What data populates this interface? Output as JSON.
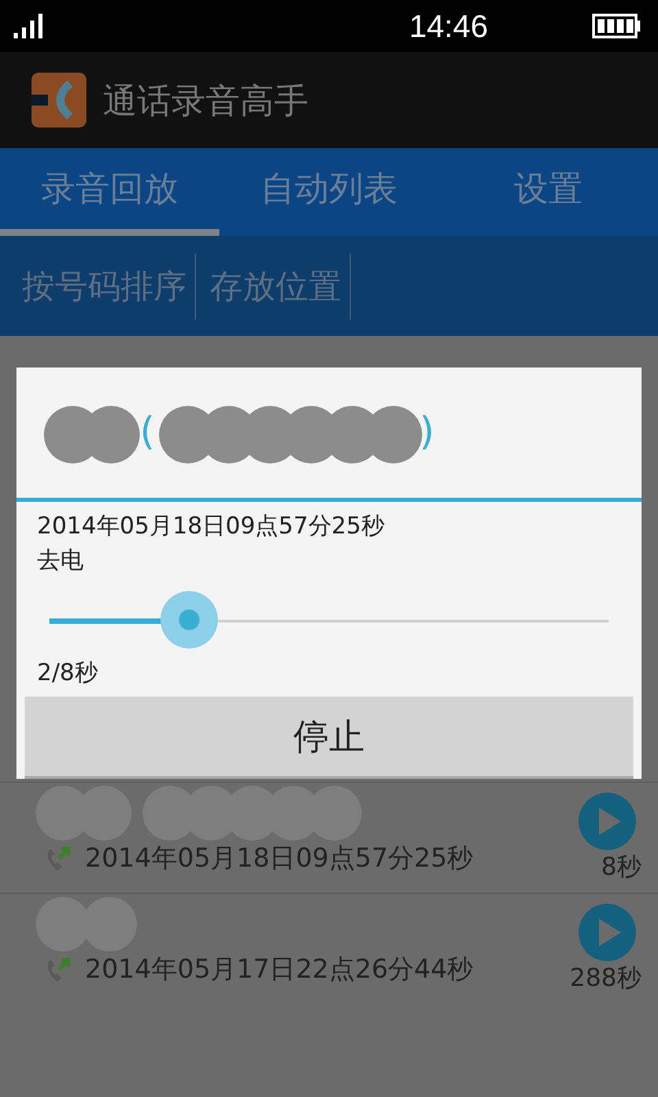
{
  "status_bar": {
    "time": "14:46"
  },
  "app_bar": {
    "title": "通话录音高手"
  },
  "tabs": [
    {
      "label": "录音回放",
      "selected": true
    },
    {
      "label": "自动列表",
      "selected": false
    },
    {
      "label": "设置",
      "selected": false
    }
  ],
  "toolbar": [
    "按号码排序",
    "存放位置"
  ],
  "dialog": {
    "title_open": "(",
    "title_close": ")",
    "date": "2014年05月18日09点57分25秒",
    "direction": "去电",
    "progress": {
      "level": 0.25
    },
    "elapsed": "2/8秒",
    "stop_button": "停止"
  },
  "recordings": [
    {
      "date": "2014年05月18日09点57分25秒",
      "duration": "8秒"
    },
    {
      "date": "2014年05月17日22点26分44秒",
      "duration": "288秒"
    }
  ]
}
